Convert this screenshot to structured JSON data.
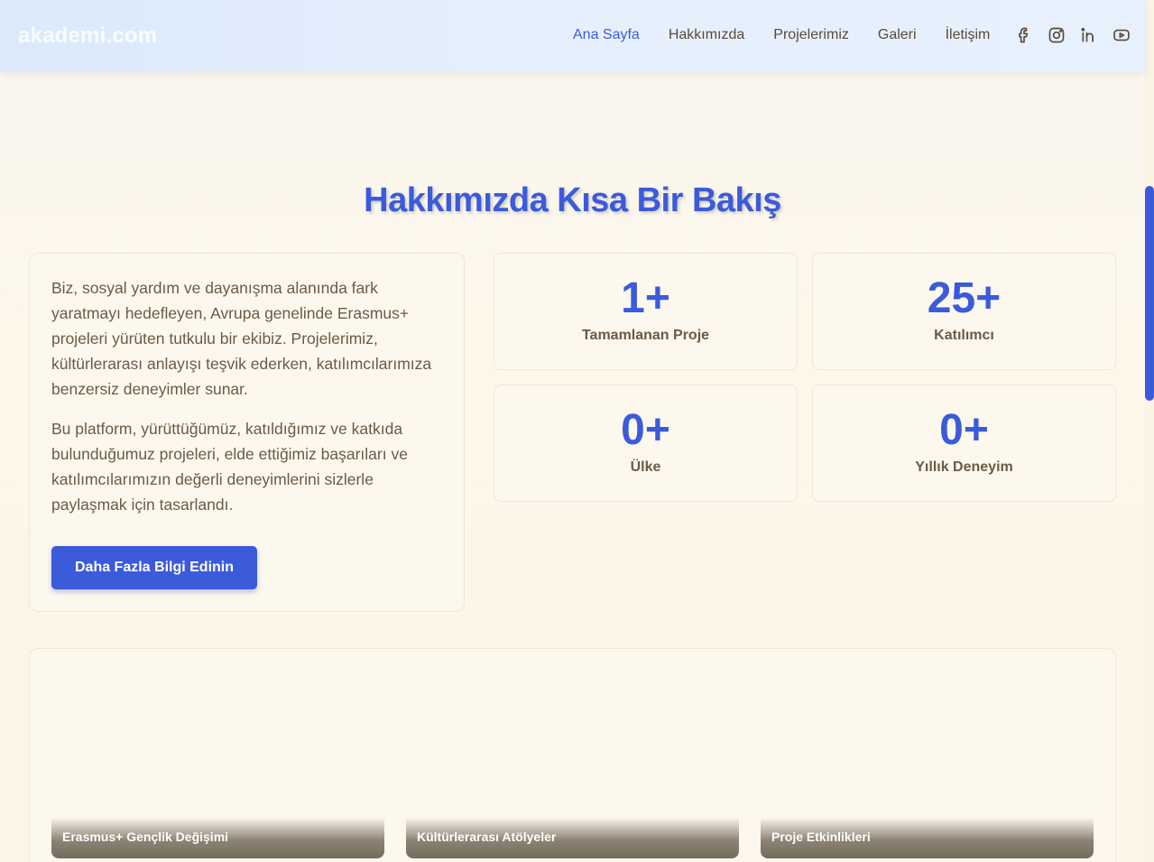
{
  "header": {
    "logo": "akademi.com",
    "nav": [
      "Ana Sayfa",
      "Hakkımızda",
      "Projelerimiz",
      "Galeri",
      "İletişim"
    ],
    "active_nav": "Ana Sayfa",
    "socials": [
      "facebook-icon",
      "instagram-icon",
      "linkedin-icon",
      "youtube-icon"
    ]
  },
  "about": {
    "title": "Hakkımızda Kısa Bir Bakış",
    "paragraphs": [
      "Biz, sosyal yardım ve dayanışma alanında fark yaratmayı hedefleyen, Avrupa genelinde Erasmus+ projeleri yürüten tutkulu bir ekibiz. Projelerimiz, kültürlerarası anlayışı teşvik ederken, katılımcılarımıza benzersiz deneyimler sunar.",
      "Bu platform, yürüttüğümüz, katıldığımız ve katkıda bulunduğumuz projeleri, elde ettiğimiz başarıları ve katılımcılarımızın değerli deneyimlerini sizlerle paylaşmak için tasarlandı."
    ],
    "button_label": "Daha Fazla Bilgi Edinin"
  },
  "stats": [
    {
      "value": "1+",
      "label": "Tamamlanan Proje"
    },
    {
      "value": "25+",
      "label": "Katılımcı"
    },
    {
      "value": "0+",
      "label": "Ülke"
    },
    {
      "value": "0+",
      "label": "Yıllık Deneyim"
    }
  ],
  "gallery": [
    {
      "caption": "Erasmus+ Gençlik Değişimi"
    },
    {
      "caption": "Kültürlerarası Atölyeler"
    },
    {
      "caption": "Proje Etkinlikleri"
    }
  ],
  "colors": {
    "accent": "#3b5bdb",
    "text": "#6b5a45",
    "background": "#fdf7ea"
  }
}
